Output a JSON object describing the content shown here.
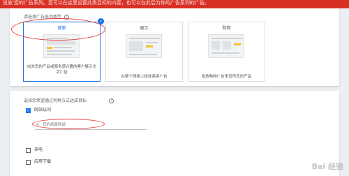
{
  "banner": {
    "text": "投放'您的广告系列。您可以在这里设置此类目标的内容，也可以在此后为你的广告系列的广告。"
  },
  "section1": {
    "question": "请选择广告系列类型",
    "help_glyph": "?",
    "tiles": [
      {
        "title": "搜索",
        "desc": "向对您的产品或服务感兴趣的客户展示文字广告",
        "selected": true
      },
      {
        "title": "展示",
        "desc": "在整个网络上投放各类广告",
        "selected": false
      },
      {
        "title": "购物",
        "desc": "投放购物广告来宣传您的产品",
        "selected": false
      }
    ],
    "check_glyph": "✓"
  },
  "section2": {
    "question": "选择您希望通过何种方式达成目标",
    "help_glyph": "?",
    "options": [
      {
        "label": "网站访问",
        "checked": true
      },
      {
        "label": "来电",
        "checked": false
      },
      {
        "label": "应用下载",
        "checked": false
      }
    ],
    "url_input": {
      "placeholder": "您的商家网站",
      "value": ""
    },
    "link_glyph": "⊘"
  },
  "watermark": {
    "text": "Bai 经验"
  },
  "colors": {
    "banner": "#d93025",
    "accent": "#1a73e8",
    "annotation": "#e53935",
    "highlight": "#f6c12b"
  }
}
